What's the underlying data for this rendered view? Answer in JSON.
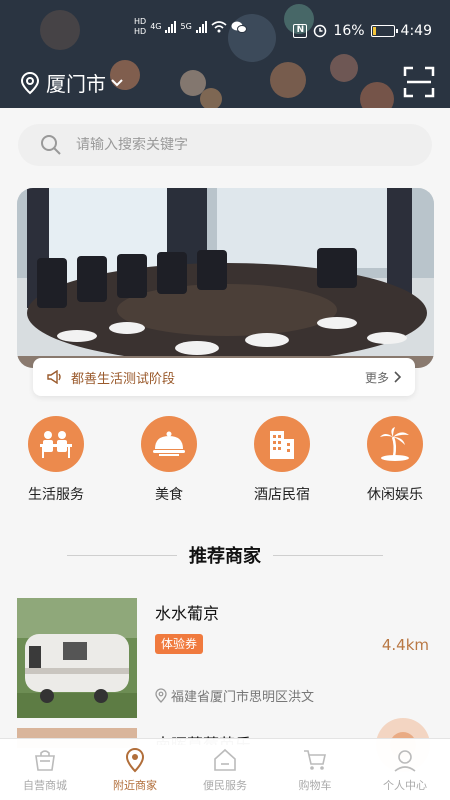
{
  "status_bar": {
    "network_badge_top": "HD",
    "network_badge_bottom": "HD",
    "net_4g": "4G",
    "net_5g": "5G",
    "nfc_label": "N",
    "battery_text": "16%",
    "battery_level": 0.16,
    "time": "4:49"
  },
  "header": {
    "city": "厦门市",
    "location_icon": "location-pin-icon",
    "dropdown_icon": "chevron-down-icon",
    "scan_icon": "scan-icon"
  },
  "search": {
    "placeholder": "请输入搜索关键字",
    "icon": "search-icon"
  },
  "notice": {
    "text": "都善生活测试阶段",
    "more": "更多",
    "icon": "megaphone-icon"
  },
  "categories": [
    {
      "label": "生活服务",
      "icon": "people-service-icon"
    },
    {
      "label": "美食",
      "icon": "food-cloche-icon"
    },
    {
      "label": "酒店民宿",
      "icon": "hotel-building-icon"
    },
    {
      "label": "休闲娱乐",
      "icon": "palm-island-icon"
    }
  ],
  "section": {
    "title": "推荐商家"
  },
  "merchants": [
    {
      "name": "水水葡京",
      "tag": "体验券",
      "distance": "4.4km",
      "address": "福建省厦门市思明区洪文"
    },
    {
      "name": "南晖草莓芭乐"
    }
  ],
  "tabbar": [
    {
      "label": "自营商城",
      "icon": "shopping-bag-icon",
      "active": false
    },
    {
      "label": "附近商家",
      "icon": "location-pin-icon",
      "active": true
    },
    {
      "label": "便民服务",
      "icon": "house-icon",
      "active": false
    },
    {
      "label": "购物车",
      "icon": "cart-icon",
      "active": false
    },
    {
      "label": "个人中心",
      "icon": "user-icon",
      "active": false
    }
  ],
  "colors": {
    "accent": "#ec8a4d",
    "active_tab": "#b16e3a",
    "header_bg": "#2a3441"
  }
}
